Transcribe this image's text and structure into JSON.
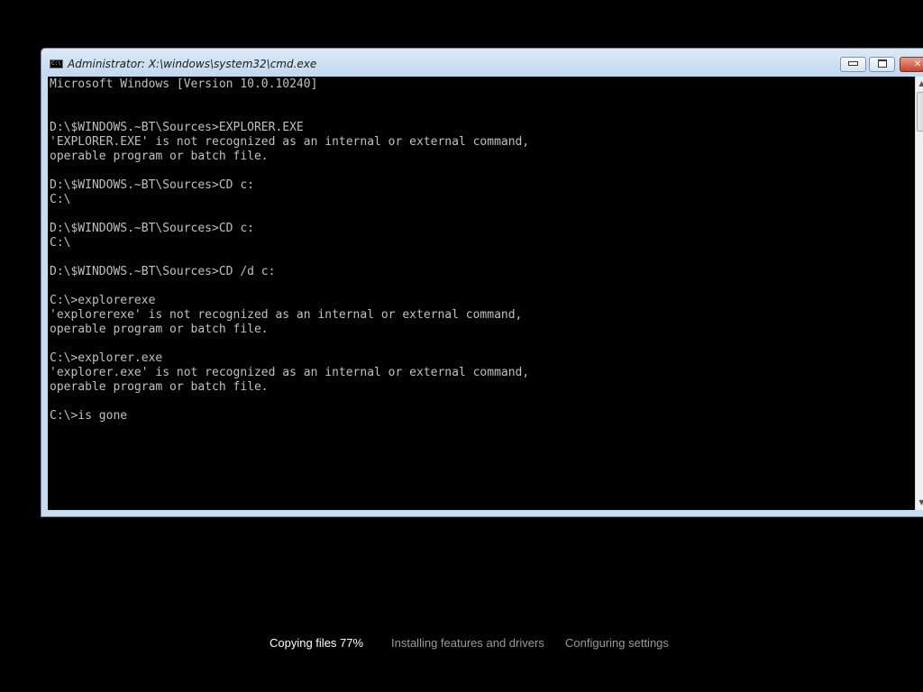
{
  "window": {
    "title": "Administrator: X:\\windows\\system32\\cmd.exe",
    "icon": "cmd-window-icon",
    "icon_text": "C:\\",
    "buttons": {
      "minimize_icon": "minimize-icon",
      "maximize_icon": "maximize-icon",
      "close_label": "✕"
    },
    "scroll_up_label": "▲",
    "scroll_down_label": "▼"
  },
  "console": {
    "lines": [
      "Microsoft Windows [Version 10.0.10240]",
      "",
      "",
      "D:\\$WINDOWS.~BT\\Sources>EXPLORER.EXE",
      "'EXPLORER.EXE' is not recognized as an internal or external command,",
      "operable program or batch file.",
      "",
      "D:\\$WINDOWS.~BT\\Sources>CD c:",
      "C:\\",
      "",
      "D:\\$WINDOWS.~BT\\Sources>CD c:",
      "C:\\",
      "",
      "D:\\$WINDOWS.~BT\\Sources>CD /d c:",
      "",
      "C:\\>explorerexe",
      "'explorerexe' is not recognized as an internal or external command,",
      "operable program or batch file.",
      "",
      "C:\\>explorer.exe",
      "'explorer.exe' is not recognized as an internal or external command,",
      "operable program or batch file.",
      "",
      "C:\\>is gone"
    ]
  },
  "setup": {
    "steps": [
      {
        "label": "Copying files 77%",
        "active": true
      },
      {
        "label": "Installing features and drivers",
        "active": false
      },
      {
        "label": "Configuring settings",
        "active": false
      }
    ],
    "colors": {
      "active": "#ffffff",
      "inactive": "#9a9a9a"
    }
  },
  "colors": {
    "background": "#000000",
    "console_text": "#c0c0c0",
    "window_frame": "#c6dcef"
  }
}
